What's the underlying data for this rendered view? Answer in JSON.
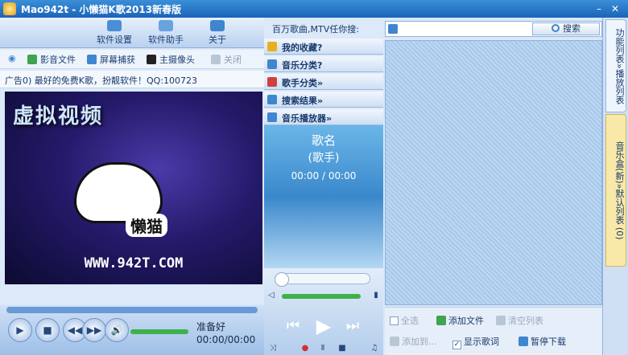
{
  "window": {
    "title": "Mao942t - 小懒猫K歌2013新春版",
    "minimize": "–",
    "close": "✕"
  },
  "toolbar": {
    "items": [
      {
        "label": "软件设置",
        "icon": "settings-icon",
        "color": "#4a8fd6"
      },
      {
        "label": "软件助手",
        "icon": "helper-icon",
        "color": "#6aa2e0"
      },
      {
        "label": "关于",
        "icon": "about-icon",
        "color": "#3f86cf"
      }
    ]
  },
  "actions": {
    "items": [
      {
        "label": "影音文件",
        "icon": "media-file-icon",
        "color": "#3fa34f"
      },
      {
        "label": "屏幕捕获",
        "icon": "screen-capture-icon",
        "color": "#3f86cf"
      },
      {
        "label": "主摄像头",
        "icon": "camera-icon",
        "color": "#222222"
      },
      {
        "label": "关闭",
        "icon": "close-icon",
        "color": "#b9c6d6"
      }
    ]
  },
  "ad": {
    "text": "广告0) 最好的免费K歌，扮靓软件！QQ:100723"
  },
  "video": {
    "watermark": "虚拟视频",
    "logo_text": "懒猫",
    "url": "WWW.942T.COM"
  },
  "player": {
    "status": "准备好",
    "time": "00:00/00:00",
    "buttons": [
      "▶",
      "■",
      "◀◀",
      "▶▶",
      "🔊"
    ]
  },
  "middle": {
    "search_prompt": "百万歌曲,MTV任你搜:",
    "menu": [
      {
        "label": "我的收藏?",
        "icon": "favorites-icon",
        "color": "#e8b020"
      },
      {
        "label": "音乐分类?",
        "icon": "music-category-icon",
        "color": "#3f86cf"
      },
      {
        "label": "歌手分类»",
        "icon": "singer-category-icon",
        "color": "#d04040"
      },
      {
        "label": "搜索结果»",
        "icon": "search-results-icon",
        "color": "#3f86cf"
      },
      {
        "label": "音乐播放器»",
        "icon": "music-player-icon",
        "color": "#3f86cf"
      }
    ],
    "now_playing": {
      "song": "歌名",
      "artist": "(歌手)",
      "time": "00:00 / 00:00"
    },
    "controls": {
      "prev": "⏮",
      "play": "▶",
      "next": "⏭"
    }
  },
  "search": {
    "placeholder": "",
    "button": "搜索"
  },
  "list_controls": {
    "select_all": "全选",
    "add_file": "添加文件",
    "clear_list": "清空列表",
    "add_to": "添加到...",
    "show_lyrics": "显示歌词",
    "pause_download": "暂停下载"
  },
  "vtabs": [
    "功能列表»播放列表",
    "音乐盒(新)»默认列表 (0)"
  ]
}
